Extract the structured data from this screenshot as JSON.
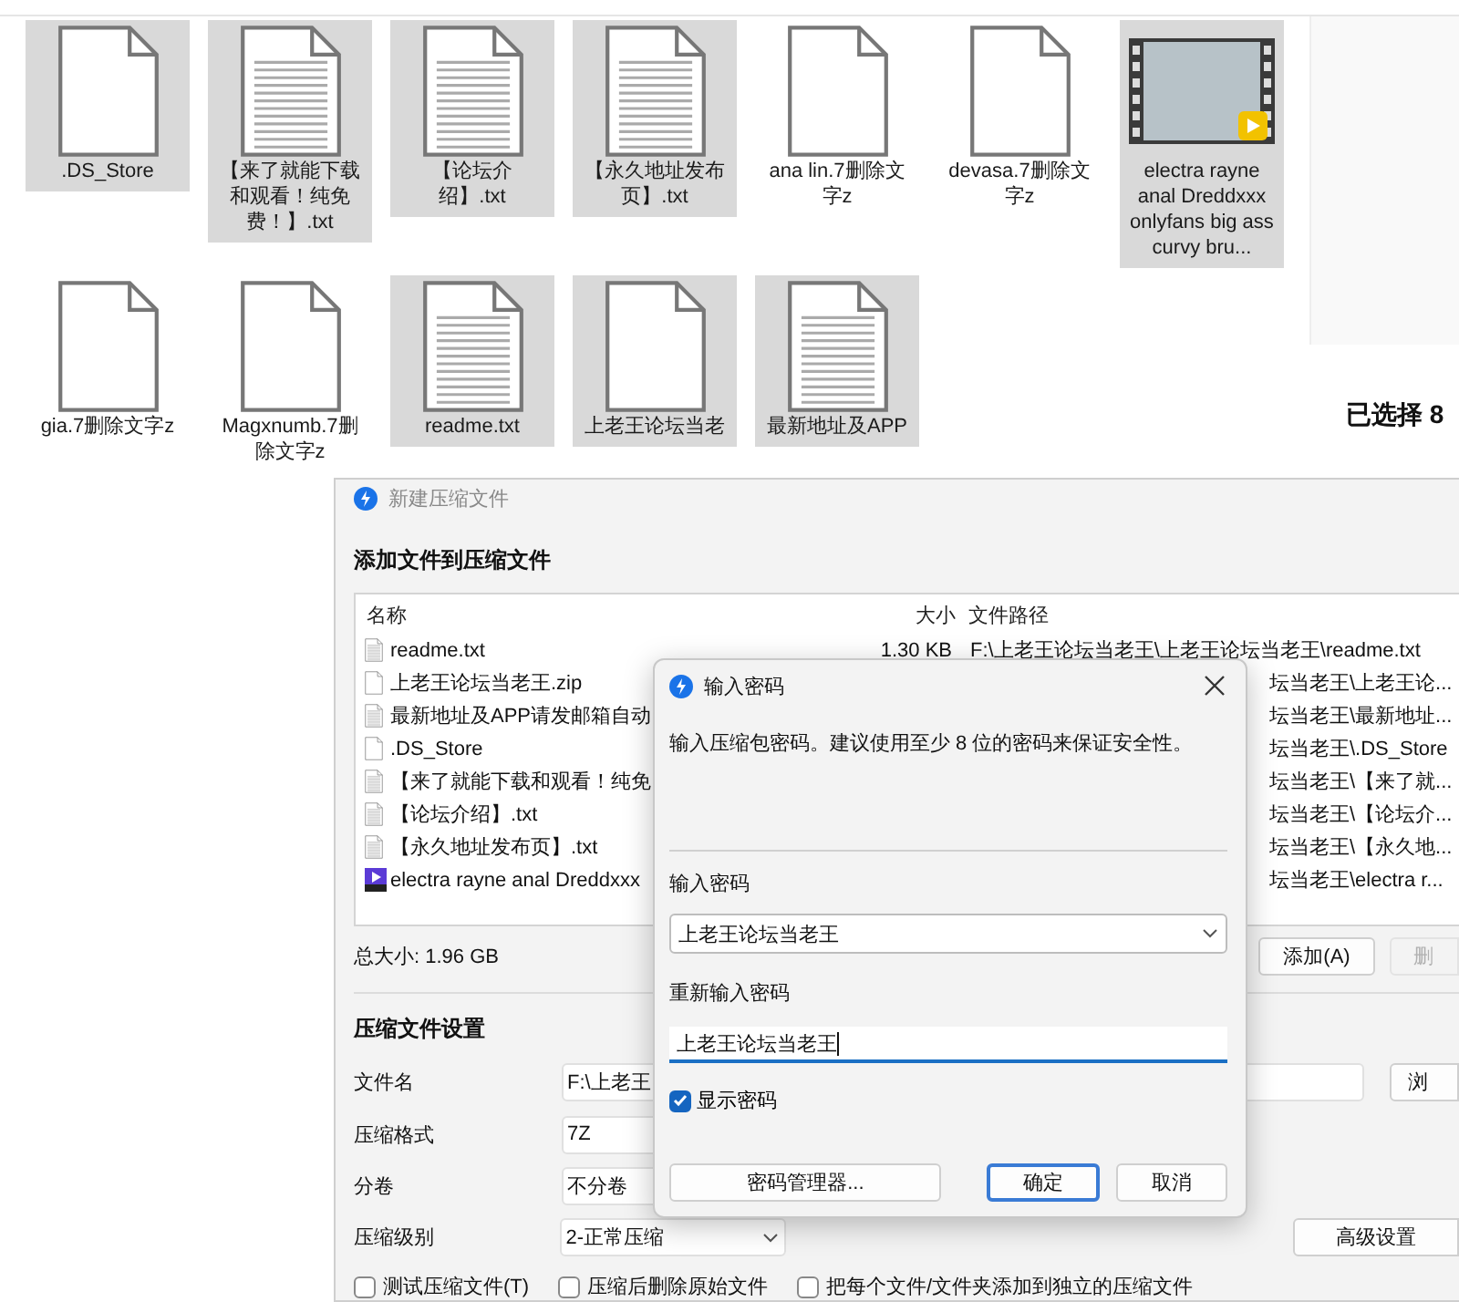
{
  "explorer": {
    "files": [
      {
        "name": ".DS_Store",
        "kind": "blank",
        "selected": true
      },
      {
        "name": "【来了就能下载和观看！纯免费！】.txt",
        "kind": "lined",
        "selected": true
      },
      {
        "name": "【论坛介绍】.txt",
        "kind": "lined",
        "selected": true
      },
      {
        "name": "【永久地址发布页】.txt",
        "kind": "lined",
        "selected": true
      },
      {
        "name": "ana lin.7删除文字z",
        "kind": "blank",
        "selected": false
      },
      {
        "name": "devasa.7删除文字z",
        "kind": "blank",
        "selected": false
      },
      {
        "name": "electra rayne anal Dreddxxx onlyfans big ass curvy bru...",
        "kind": "video",
        "selected": true
      },
      {
        "name": "gia.7删除文字z",
        "kind": "blank",
        "selected": false
      },
      {
        "name": "Magxnumb.7删除文字z",
        "kind": "blank",
        "selected": false
      },
      {
        "name": "readme.txt",
        "kind": "lined",
        "selected": true
      },
      {
        "name": "上老王论坛当老",
        "kind": "blank",
        "selected": true
      },
      {
        "name": "最新地址及APP",
        "kind": "lined",
        "selected": true
      }
    ],
    "selection_label": "已选择 8"
  },
  "compress_dialog": {
    "title": "新建压缩文件",
    "section_title": "添加文件到压缩文件",
    "columns": [
      "名称",
      "大小",
      "文件路径"
    ],
    "rows": [
      {
        "kind": "lined",
        "name": "readme.txt",
        "size": "1.30 KB",
        "path": "F:\\上老王论坛当老王\\上老王论坛当老王\\readme.txt"
      },
      {
        "kind": "blank",
        "name": "上老王论坛当老王.zip",
        "path": "坛当老王\\上老王论..."
      },
      {
        "kind": "lined",
        "name": "最新地址及APP请发邮箱自动",
        "path": "坛当老王\\最新地址..."
      },
      {
        "kind": "blank",
        "name": ".DS_Store",
        "path": "坛当老王\\.DS_Store"
      },
      {
        "kind": "lined",
        "name": "【来了就能下载和观看！纯免",
        "path": "坛当老王\\【来了就..."
      },
      {
        "kind": "lined",
        "name": "【论坛介绍】.txt",
        "path": "坛当老王\\【论坛介..."
      },
      {
        "kind": "lined",
        "name": "【永久地址发布页】.txt",
        "path": "坛当老王\\【永久地..."
      },
      {
        "kind": "video",
        "name": "electra rayne anal Dreddxxx",
        "path": "坛当老王\\electra r..."
      }
    ],
    "total_size": "总大小: 1.96 GB",
    "add_button": "添加(A)",
    "remove_button": {
      "label": "删",
      "disabled": true
    },
    "settings_title": "压缩文件设置",
    "settings": [
      {
        "label": "文件名",
        "value": "F:\\上老王",
        "kind": "path"
      },
      {
        "label": "压缩格式",
        "value": "7Z",
        "kind": "text"
      },
      {
        "label": "分卷",
        "value": "不分卷",
        "kind": "text"
      },
      {
        "label": "压缩级别",
        "value": "2-正常压缩",
        "kind": "dropdown"
      }
    ],
    "browse_button": "浏",
    "advanced_button": "高级设置",
    "options": [
      {
        "label": "测试压缩文件(T)",
        "checked": false
      },
      {
        "label": "压缩后删除原始文件",
        "checked": false
      },
      {
        "label": "把每个文件/文件夹添加到独立的压缩文件",
        "checked": false
      }
    ]
  },
  "password_dialog": {
    "title": "输入密码",
    "description": "输入压缩包密码。建议使用至少 8 位的密码来保证安全性。",
    "password_label": "输入密码",
    "password_value": "上老王论坛当老王",
    "confirm_label": "重新输入密码",
    "confirm_value": "上老王论坛当老王",
    "show_password": {
      "label": "显示密码",
      "checked": true
    },
    "buttons": [
      {
        "label": "密码管理器...",
        "default": false
      },
      {
        "label": "确定",
        "default": true
      },
      {
        "label": "取消",
        "default": false
      }
    ]
  }
}
